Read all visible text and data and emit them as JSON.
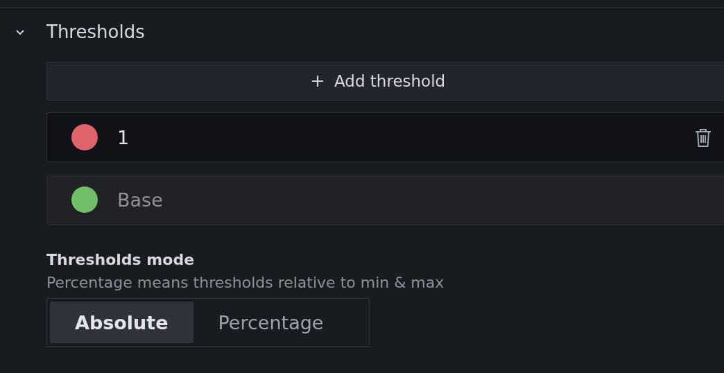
{
  "section": {
    "title": "Thresholds",
    "expanded": true
  },
  "add_button": {
    "label": "Add threshold"
  },
  "thresholds": [
    {
      "value": "1",
      "color": "#e0626a",
      "kind": "editable"
    },
    {
      "value": "Base",
      "color": "#73bf69",
      "kind": "base"
    }
  ],
  "mode": {
    "label": "Thresholds mode",
    "description": "Percentage means thresholds relative to min & max",
    "options": [
      {
        "label": "Absolute",
        "selected": true
      },
      {
        "label": "Percentage",
        "selected": false
      }
    ]
  }
}
